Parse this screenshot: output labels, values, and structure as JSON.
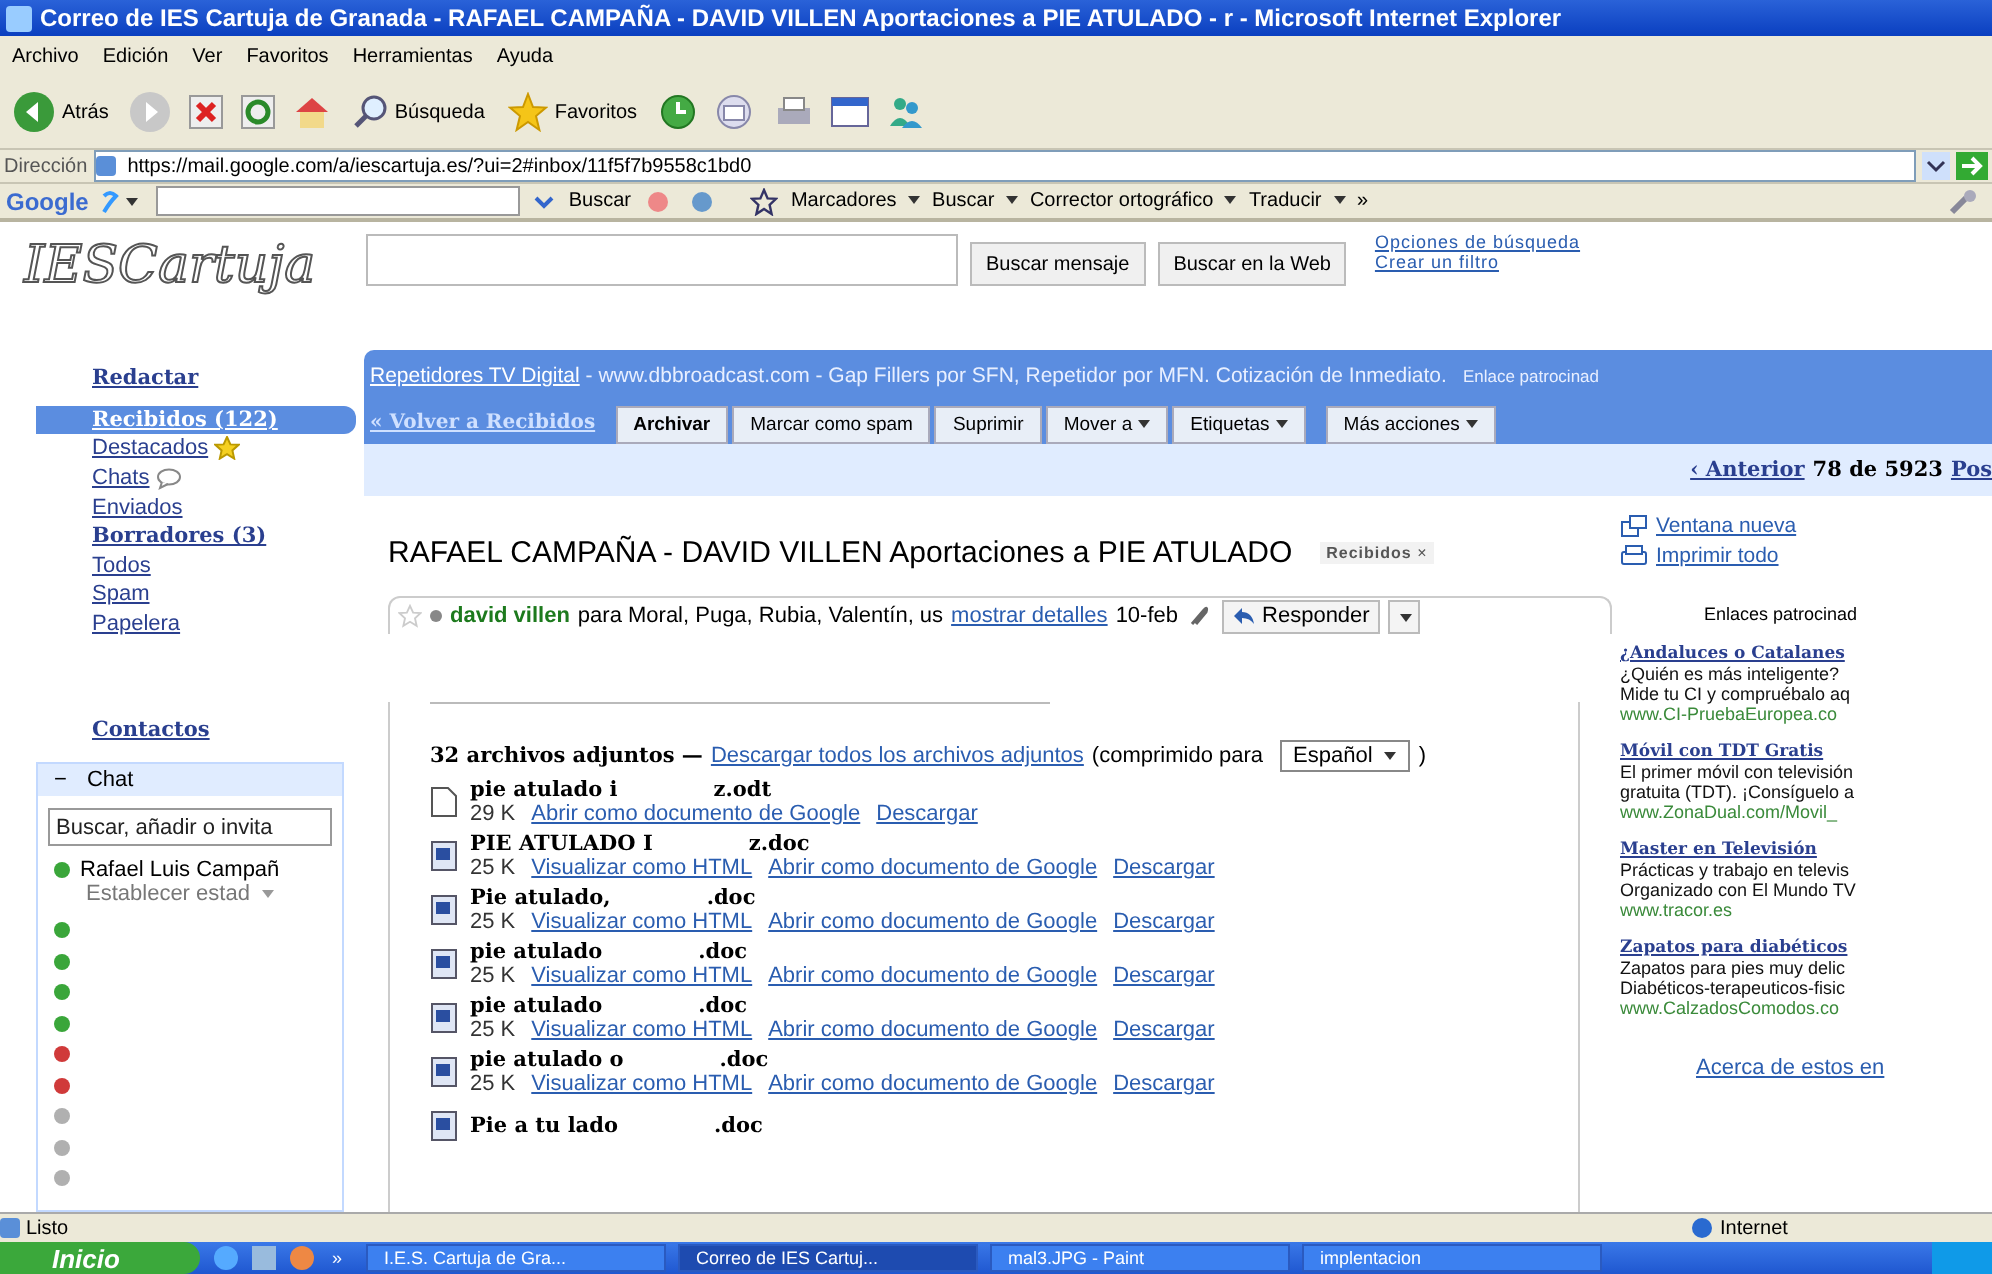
{
  "window": {
    "title": "Correo de IES Cartuja de Granada - RAFAEL CAMPAÑA - DAVID VILLEN Aportaciones a PIE ATULADO - r - Microsoft Internet Explorer"
  },
  "menu": [
    "Archivo",
    "Edición",
    "Ver",
    "Favoritos",
    "Herramientas",
    "Ayuda"
  ],
  "toolbar": {
    "back": "Atrás",
    "search": "Búsqueda",
    "favorites": "Favoritos"
  },
  "address": {
    "label": "Dirección",
    "url": "https://mail.google.com/a/iescartuja.es/?ui=2#inbox/11f5f7b9558c1bd0"
  },
  "google_toolbar": {
    "logo": "Google",
    "search_button": "Buscar",
    "items": [
      "Marcadores",
      "Buscar",
      "Corrector ortográfico",
      "Traducir"
    ],
    "more": "»"
  },
  "header": {
    "logo": "IESCartuja",
    "buttons": [
      "Buscar mensaje",
      "Buscar en la Web"
    ],
    "links": [
      "Opciones de búsqueda",
      "Crear un filtro"
    ]
  },
  "nav": [
    {
      "label": "Redactar",
      "kind": "compose",
      "selected": false,
      "bold": true
    },
    {
      "label": "Recibidos (122)",
      "kind": "plain",
      "selected": true,
      "bold": true
    },
    {
      "label": "Destacados",
      "kind": "starred",
      "selected": false,
      "bold": false
    },
    {
      "label": "Chats",
      "kind": "chats",
      "selected": false,
      "bold": false
    },
    {
      "label": "Enviados",
      "kind": "plain",
      "selected": false,
      "bold": false
    },
    {
      "label": "Borradores (3)",
      "kind": "plain",
      "selected": false,
      "bold": true
    },
    {
      "label": "Todos",
      "kind": "plain",
      "selected": false,
      "bold": false
    },
    {
      "label": "Spam",
      "kind": "plain",
      "selected": false,
      "bold": false
    },
    {
      "label": "Papelera",
      "kind": "plain",
      "selected": false,
      "bold": false
    }
  ],
  "contacts_link": "Contactos",
  "chat": {
    "title": "Chat",
    "collapse": "−",
    "search_placeholder": "Buscar, añadir o invita",
    "me": {
      "name": "Rafael Luis Campañ",
      "status": "Establecer estad",
      "color": "#3aa63a"
    },
    "contacts": [
      {
        "color": "#3aa63a"
      },
      {
        "color": "#3aa63a"
      },
      {
        "color": "#3aa63a"
      },
      {
        "color": "#3aa63a"
      },
      {
        "color": "#d03a3a"
      },
      {
        "color": "#d03a3a"
      },
      {
        "color": "#b0b0b0"
      },
      {
        "color": "#b0b0b0"
      },
      {
        "color": "#b0b0b0"
      }
    ]
  },
  "ad_bar": {
    "link": "Repetidores TV Digital",
    "text": " - www.dbbroadcast.com - Gap Fillers por SFN, Repetidor por MFN. Cotización de Inmediato.",
    "sponsor": "Enlace patrocinad"
  },
  "actions": {
    "back": "« Volver a Recibidos",
    "buttons": [
      {
        "label": "Archivar",
        "menu": false,
        "bold": true
      },
      {
        "label": "Marcar como spam",
        "menu": false,
        "bold": false
      },
      {
        "label": "Suprimir",
        "menu": false,
        "bold": false
      },
      {
        "label": "Mover a",
        "menu": true,
        "bold": false
      },
      {
        "label": "Etiquetas",
        "menu": true,
        "bold": false
      },
      {
        "label": "Más acciones",
        "menu": true,
        "bold": false
      }
    ]
  },
  "pagination": {
    "previous": "‹ Anterior",
    "position": "78 de 5923",
    "next": "Pos"
  },
  "message": {
    "subject": "RAFAEL CAMPAÑA - DAVID VILLEN Aportaciones a PIE ATULADO",
    "label": "Recibidos",
    "remove": "×",
    "sender": "david villen",
    "recipients": "para Moral, Puga, Rubia, Valentín, us",
    "details": "mostrar detalles",
    "date": "10-feb",
    "reply": "Responder",
    "starred": false
  },
  "attachments": {
    "summary": "32 archivos adjuntos —",
    "download_all": "Descargar todos los archivos adjuntos",
    "compressed": "(comprimido para",
    "language": "Español",
    "close_paren": ")",
    "files": [
      {
        "kind": "odt",
        "name": "pie atulado i",
        "ext": "z.odt",
        "size": "29 K",
        "links": [
          "Abrir como documento de Google",
          "Descargar"
        ]
      },
      {
        "kind": "doc",
        "name": "PIE ATULADO I",
        "ext": "z.doc",
        "size": "25 K",
        "links": [
          "Visualizar como HTML",
          "Abrir como documento de Google",
          "Descargar"
        ]
      },
      {
        "kind": "doc",
        "name": "Pie atulado,",
        "ext": ".doc",
        "size": "25 K",
        "links": [
          "Visualizar como HTML",
          "Abrir como documento de Google",
          "Descargar"
        ]
      },
      {
        "kind": "doc",
        "name": "pie atulado",
        "ext": ".doc",
        "size": "25 K",
        "links": [
          "Visualizar como HTML",
          "Abrir como documento de Google",
          "Descargar"
        ]
      },
      {
        "kind": "doc",
        "name": "pie atulado",
        "ext": ".doc",
        "size": "25 K",
        "links": [
          "Visualizar como HTML",
          "Abrir como documento de Google",
          "Descargar"
        ]
      },
      {
        "kind": "doc",
        "name": "pie atulado o",
        "ext": ".doc",
        "size": "25 K",
        "links": [
          "Visualizar como HTML",
          "Abrir como documento de Google",
          "Descargar"
        ]
      },
      {
        "kind": "doc",
        "name": "Pie a tu lado",
        "ext": ".doc"
      }
    ]
  },
  "side_links": [
    {
      "kind": "window",
      "label": "Ventana nueva"
    },
    {
      "kind": "print",
      "label": "Imprimir todo"
    }
  ],
  "sponsored": {
    "title": "Enlaces patrocinad",
    "ads": [
      {
        "title": "¿Andaluces o Catalanes",
        "lines": [
          "¿Quién es más inteligente?",
          "Mide tu CI y compruébalo aq"
        ],
        "url": "www.CI-PruebaEuropea.co"
      },
      {
        "title": "Móvil con TDT Gratis",
        "lines": [
          "El primer móvil con televisión",
          "gratuita (TDT). ¡Consíguelo a"
        ],
        "url": "www.ZonaDual.com/Movil_"
      },
      {
        "title": "Master en Televisión",
        "lines": [
          "Prácticas y trabajo en televis",
          "Organizado con El Mundo TV"
        ],
        "url": "www.tracor.es"
      },
      {
        "title": "Zapatos para diabéticos",
        "lines": [
          "Zapatos para pies muy delic",
          "Diabéticos-terapeuticos-fisic"
        ],
        "url": "www.CalzadosComodos.co"
      }
    ],
    "about": "Acerca de estos en"
  },
  "status_bar": {
    "text": "Listo",
    "zone": "Internet"
  },
  "taskbar": {
    "start": "Inicio",
    "more": "»",
    "items": [
      {
        "label": "I.E.S. Cartuja de Gra...",
        "selected": false
      },
      {
        "label": "Correo de IES Cartuj...",
        "selected": true
      },
      {
        "label": "mal3.JPG - Paint",
        "selected": false
      },
      {
        "label": "implentacion",
        "selected": false
      }
    ]
  }
}
